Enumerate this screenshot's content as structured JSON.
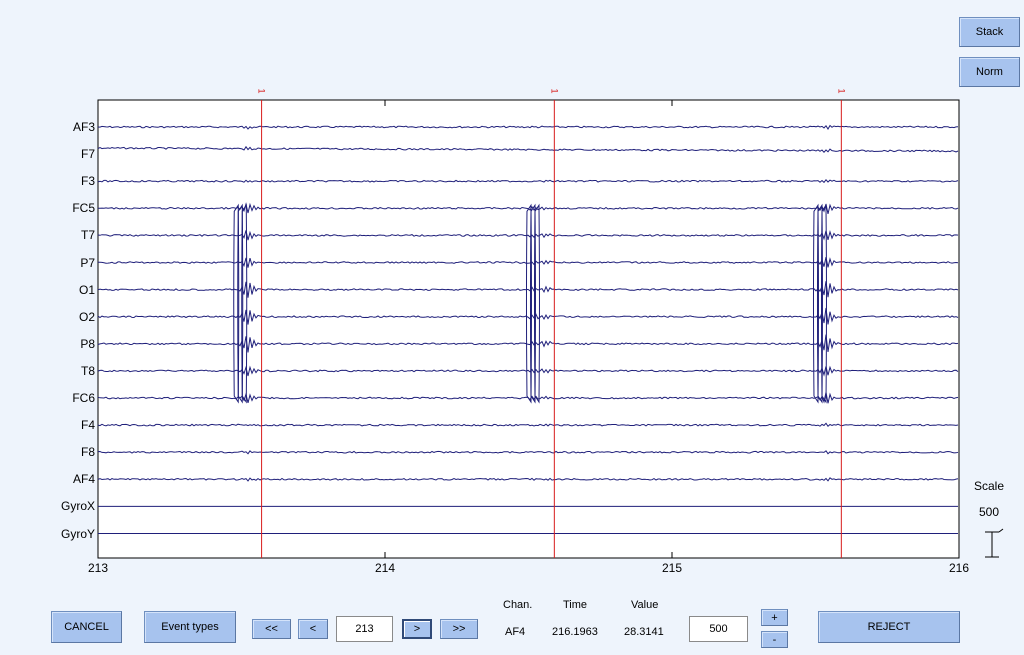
{
  "buttons": {
    "stack": "Stack",
    "norm": "Norm",
    "cancel": "CANCEL",
    "event_types": "Event types",
    "first": "<<",
    "prev": "<",
    "next": ">",
    "last": ">>",
    "plus": "+",
    "minus": "-",
    "reject": "REJECT"
  },
  "position_input": {
    "value": "213"
  },
  "scale_input": {
    "value": "500"
  },
  "readout": {
    "chan_label": "Chan.",
    "time_label": "Time",
    "value_label": "Value",
    "chan": "AF4",
    "time": "216.1963",
    "value": "28.3141"
  },
  "scale": {
    "title": "Scale",
    "value": "500"
  },
  "x_ticks": [
    "213",
    "214",
    "215",
    "216"
  ],
  "channels": [
    "AF3",
    "F7",
    "F3",
    "FC5",
    "T7",
    "P7",
    "O1",
    "O2",
    "P8",
    "T8",
    "FC6",
    "F4",
    "F8",
    "AF4",
    "GyroX",
    "GyroY"
  ],
  "events": [
    {
      "label": "1",
      "time": 213.57
    },
    {
      "label": "1",
      "time": 214.59
    },
    {
      "label": "1",
      "time": 215.59
    }
  ],
  "artifact_times": [
    213.52,
    214.54,
    215.54
  ],
  "colors": {
    "trace": "#1f1f7a",
    "event": "#d81b1b",
    "background": "#eef4fc",
    "button": "#a7c3ee"
  }
}
